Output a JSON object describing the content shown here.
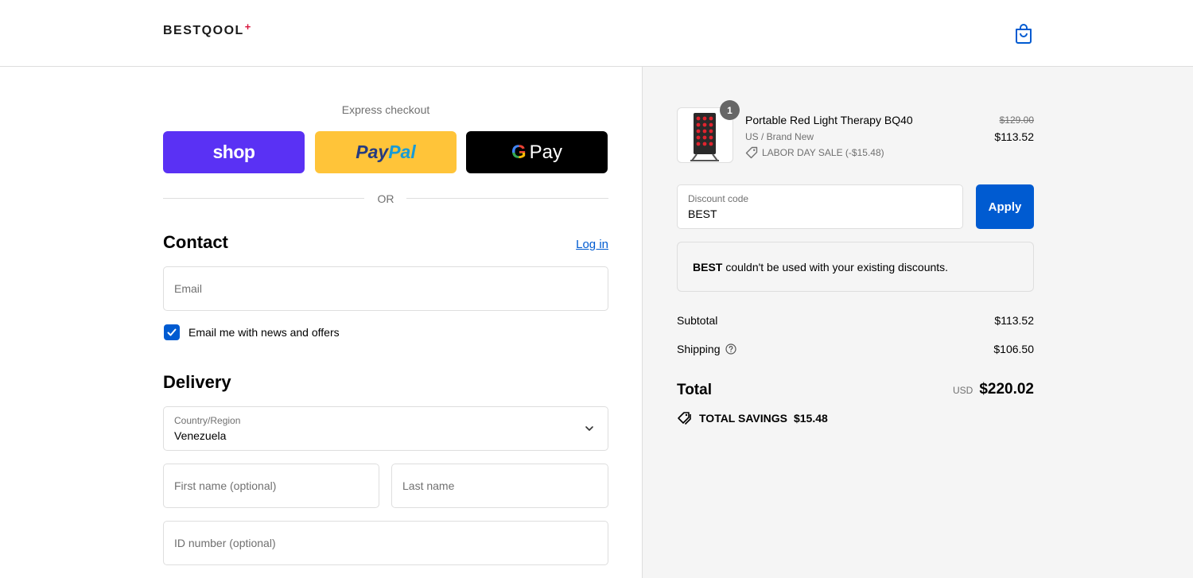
{
  "header": {
    "logo_text": "BESTQOOL",
    "logo_plus": "+",
    "cart_icon": "shopping-bag-icon"
  },
  "express": {
    "label": "Express checkout",
    "shop_label": "shop",
    "paypal_label_1": "Pay",
    "paypal_label_2": "Pal",
    "gpay_g": "G",
    "gpay_label": "Pay",
    "or_label": "OR"
  },
  "contact": {
    "title": "Contact",
    "login_label": "Log in",
    "email_placeholder": "Email",
    "newsletter_label": "Email me with news and offers",
    "newsletter_checked": true
  },
  "delivery": {
    "title": "Delivery",
    "country_label": "Country/Region",
    "country_value": "Venezuela",
    "first_name_placeholder": "First name (optional)",
    "last_name_placeholder": "Last name",
    "id_number_placeholder": "ID number (optional)"
  },
  "order": {
    "item": {
      "quantity": "1",
      "name": "Portable Red Light Therapy BQ40",
      "variant": "US / Brand New",
      "discount": "LABOR DAY SALE (-$15.48)",
      "original_price": "$129.00",
      "price": "$113.52"
    },
    "discount_field": {
      "label": "Discount code",
      "value": "BEST",
      "apply_label": "Apply"
    },
    "notice": {
      "code": "BEST",
      "message": "couldn't be used with your existing discounts."
    },
    "subtotal_label": "Subtotal",
    "subtotal_value": "$113.52",
    "shipping_label": "Shipping",
    "shipping_value": "$106.50",
    "total_label": "Total",
    "currency": "USD",
    "total_value": "$220.02",
    "savings_label": "TOTAL SAVINGS",
    "savings_value": "$15.48"
  },
  "colors": {
    "accent": "#005bd1",
    "shop_purple": "#5a31f4",
    "paypal_yellow": "#ffc439",
    "sidebar_bg": "#f5f5f5"
  }
}
